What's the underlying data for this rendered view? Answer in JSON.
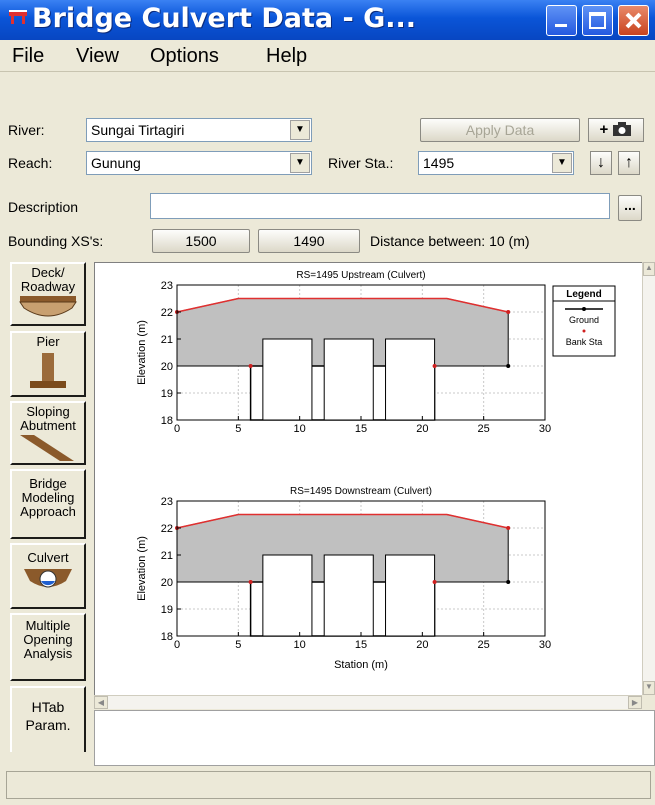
{
  "window": {
    "title": "Bridge Culvert Data - G..."
  },
  "menu": [
    "File",
    "View",
    "Options",
    "Help"
  ],
  "form": {
    "river_label": "River:",
    "river_value": "Sungai Tirtagiri",
    "apply_label": "Apply Data",
    "reach_label": "Reach:",
    "reach_value": "Gunung",
    "river_sta_label": "River Sta.:",
    "river_sta_value": "1495",
    "description_label": "Description",
    "description_value": "",
    "description_button": "...",
    "bounding_label": "Bounding XS's:",
    "bounding_up": "1500",
    "bounding_down": "1490",
    "distance_text": "Distance between: 10 (m)"
  },
  "sidebar": [
    {
      "label": "Deck/ Roadway",
      "icon": "deck-roadway-icon"
    },
    {
      "label": "Pier",
      "icon": "pier-icon"
    },
    {
      "label": "Sloping Abutment",
      "icon": "sloping-abutment-icon"
    },
    {
      "label": "Bridge Modeling Approach",
      "icon": ""
    },
    {
      "label": "Culvert",
      "icon": "culvert-icon"
    },
    {
      "label": "Multiple Opening Analysis",
      "icon": ""
    },
    {
      "label": "HTab Param.",
      "icon": ""
    }
  ],
  "chart_data": [
    {
      "type": "area",
      "title": "RS=1495   Upstream  (Culvert)",
      "xlabel": "",
      "ylabel": "Elevation (m)",
      "xlim": [
        0,
        30
      ],
      "ylim": [
        18,
        23
      ],
      "xticks": [
        0,
        5,
        10,
        15,
        20,
        25,
        30
      ],
      "yticks": [
        18,
        19,
        20,
        21,
        22,
        23
      ],
      "series": [
        {
          "name": "Ground",
          "x": [
            6,
            6,
            21,
            21
          ],
          "y": [
            18,
            20,
            20,
            18
          ]
        },
        {
          "name": "Bank Sta",
          "x": [
            6,
            21
          ],
          "y": [
            20,
            20
          ]
        }
      ],
      "deck": {
        "x": [
          0,
          5,
          22,
          27
        ],
        "y": [
          22,
          22.5,
          22.5,
          22
        ]
      },
      "culverts": [
        [
          7,
          11
        ],
        [
          12,
          16
        ],
        [
          17,
          21
        ]
      ],
      "culvert_top": 21
    },
    {
      "type": "area",
      "title": "RS=1495   Downstream  (Culvert)",
      "xlabel": "Station (m)",
      "ylabel": "Elevation (m)",
      "xlim": [
        0,
        30
      ],
      "ylim": [
        18,
        23
      ],
      "xticks": [
        0,
        5,
        10,
        15,
        20,
        25,
        30
      ],
      "yticks": [
        18,
        19,
        20,
        21,
        22,
        23
      ],
      "series": [
        {
          "name": "Ground",
          "x": [
            6,
            6,
            21,
            21
          ],
          "y": [
            18,
            20,
            20,
            18
          ]
        },
        {
          "name": "Bank Sta",
          "x": [
            6,
            21
          ],
          "y": [
            20,
            20
          ]
        }
      ],
      "deck": {
        "x": [
          0,
          5,
          22,
          27
        ],
        "y": [
          22,
          22.5,
          22.5,
          22
        ]
      },
      "culverts": [
        [
          7,
          11
        ],
        [
          12,
          16
        ],
        [
          17,
          21
        ]
      ],
      "culvert_top": 21
    }
  ],
  "legend": {
    "title": "Legend",
    "items": [
      "Ground",
      "Bank Sta"
    ]
  },
  "colors": {
    "deck": "#c0c0c0",
    "deck_edge": "#e03030",
    "title_bar": "#0a55d8",
    "close": "#c8431f"
  }
}
